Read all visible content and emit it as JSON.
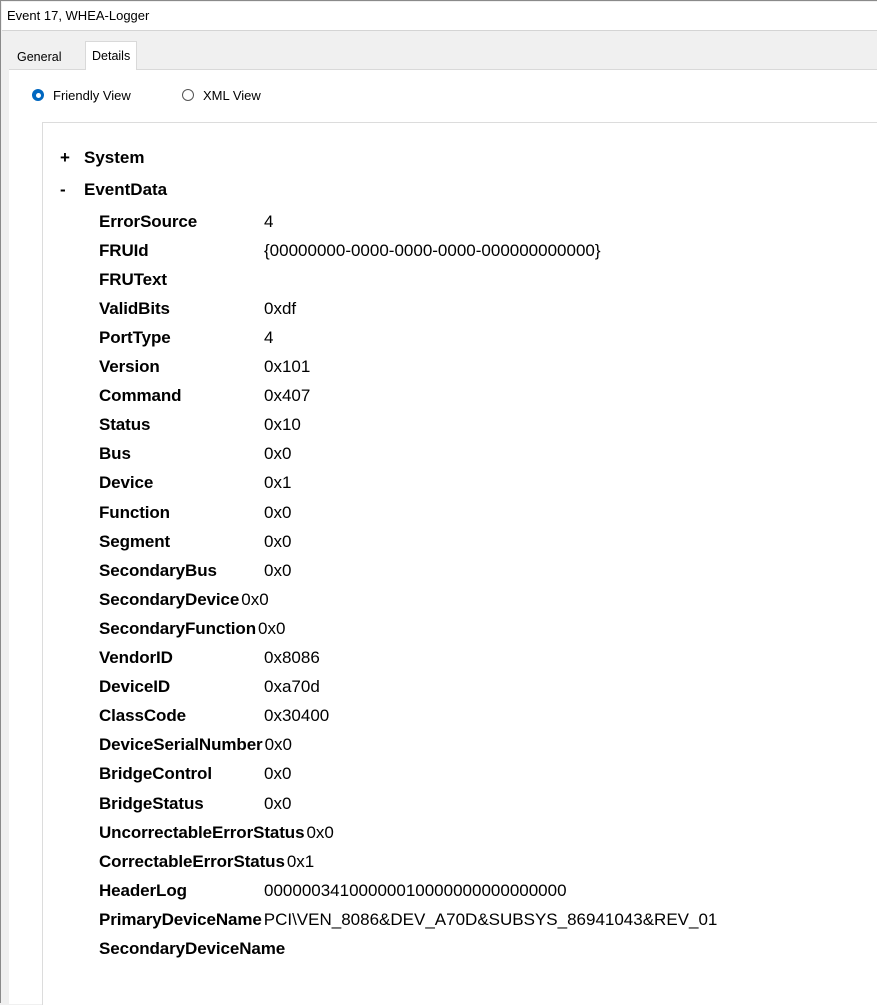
{
  "window": {
    "title": "Event 17, WHEA-Logger"
  },
  "tabs": [
    {
      "label": "General"
    },
    {
      "label": "Details"
    }
  ],
  "view_options": {
    "friendly_label": "Friendly View",
    "xml_label": "XML View",
    "selected": "Friendly View"
  },
  "tree": {
    "system": {
      "toggle": "+",
      "label": "System"
    },
    "eventdata": {
      "toggle": "-",
      "label": "EventData"
    }
  },
  "event_data": [
    {
      "key": "ErrorSource",
      "value": "4"
    },
    {
      "key": "FRUId",
      "value": "{00000000-0000-0000-0000-000000000000}"
    },
    {
      "key": "FRUText",
      "value": ""
    },
    {
      "key": "ValidBits",
      "value": "0xdf"
    },
    {
      "key": "PortType",
      "value": "4"
    },
    {
      "key": "Version",
      "value": "0x101"
    },
    {
      "key": "Command",
      "value": "0x407"
    },
    {
      "key": "Status",
      "value": "0x10"
    },
    {
      "key": "Bus",
      "value": "0x0"
    },
    {
      "key": "Device",
      "value": "0x1"
    },
    {
      "key": "Function",
      "value": "0x0"
    },
    {
      "key": "Segment",
      "value": "0x0"
    },
    {
      "key": "SecondaryBus",
      "value": "0x0"
    },
    {
      "key": "SecondaryDevice",
      "value": "0x0"
    },
    {
      "key": "SecondaryFunction",
      "value": "0x0"
    },
    {
      "key": "VendorID",
      "value": "0x8086"
    },
    {
      "key": "DeviceID",
      "value": "0xa70d"
    },
    {
      "key": "ClassCode",
      "value": "0x30400"
    },
    {
      "key": "DeviceSerialNumber",
      "value": "0x0"
    },
    {
      "key": "BridgeControl",
      "value": "0x0"
    },
    {
      "key": "BridgeStatus",
      "value": "0x0"
    },
    {
      "key": "UncorrectableErrorStatus",
      "value": "0x0"
    },
    {
      "key": "CorrectableErrorStatus",
      "value": "0x1"
    },
    {
      "key": "HeaderLog",
      "value": "00000034100000010000000000000000"
    },
    {
      "key": "PrimaryDeviceName",
      "value": "PCI\\VEN_8086&DEV_A70D&SUBSYS_86941043&REV_01"
    },
    {
      "key": "SecondaryDeviceName",
      "value": ""
    }
  ]
}
